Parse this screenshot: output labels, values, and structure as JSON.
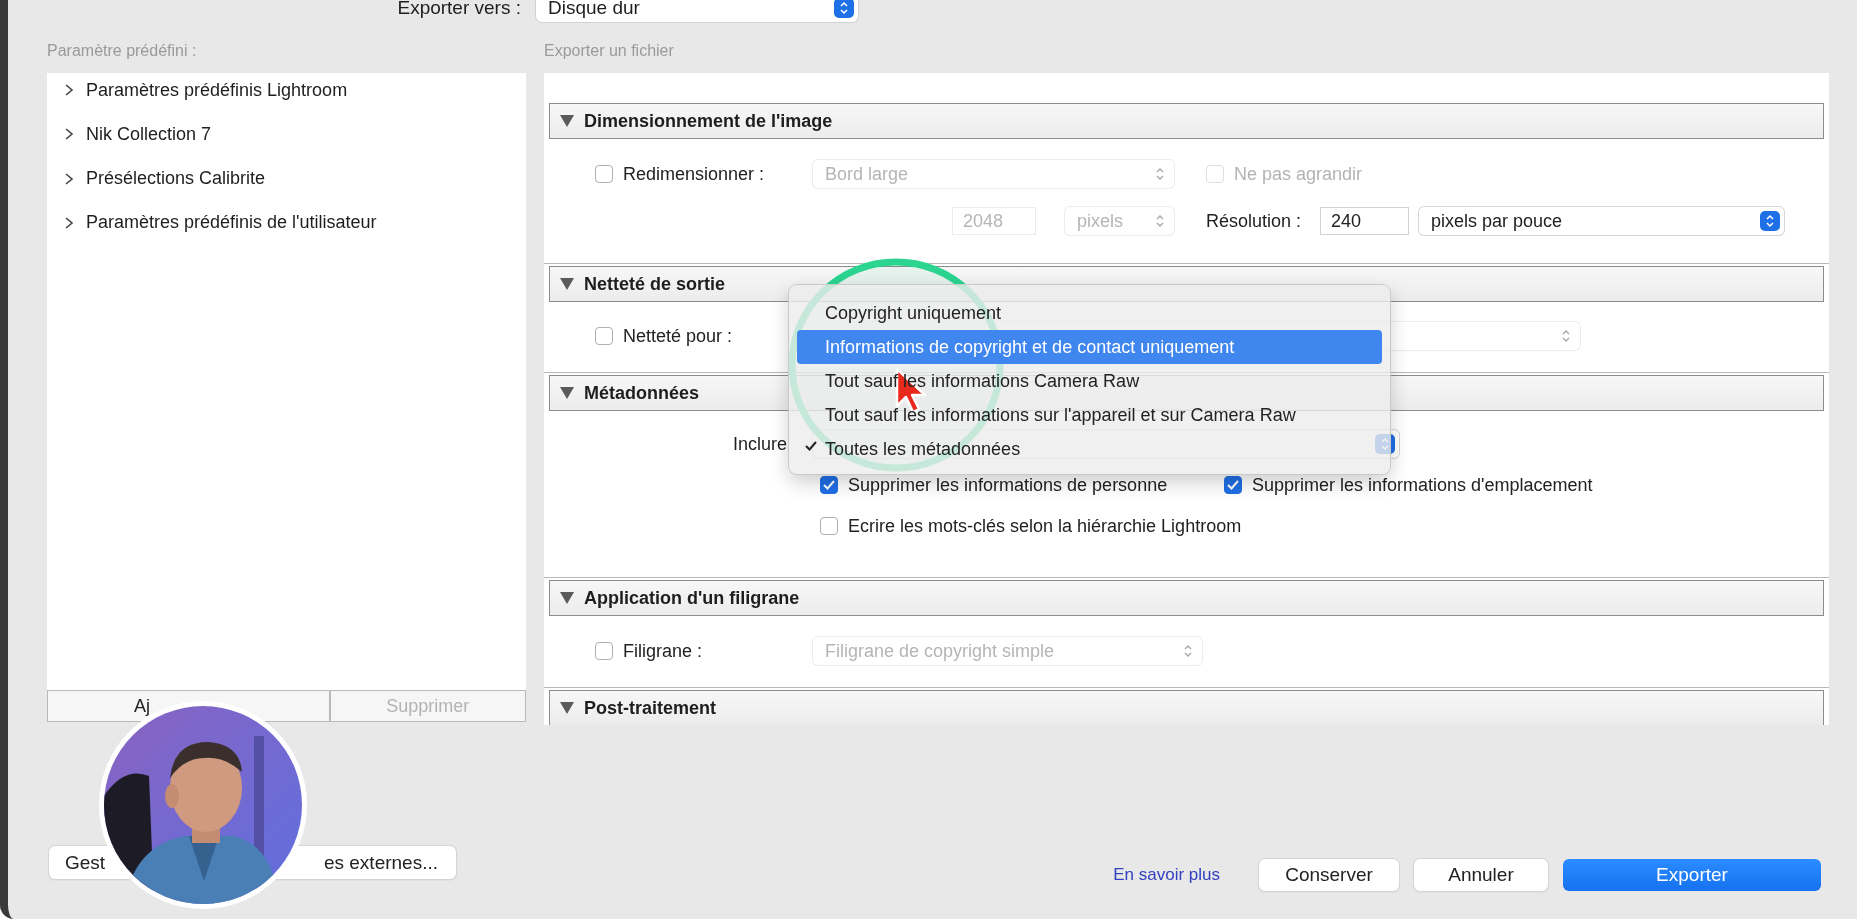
{
  "export_to": {
    "label": "Exporter vers :",
    "value": "Disque dur"
  },
  "presets": {
    "label": "Paramètre prédéfini :",
    "items": [
      {
        "label": "Paramètres prédéfinis Lightroom",
        "expanded": false
      },
      {
        "label": "Nik Collection 7",
        "expanded": false
      },
      {
        "label": "Présélections Calibrite",
        "expanded": false
      },
      {
        "label": "Paramètres prédéfinis de l'utilisateur",
        "expanded": false
      }
    ],
    "buttons": [
      {
        "label": "Aj",
        "disabled": false
      },
      {
        "label": "Supprimer",
        "disabled": true
      }
    ]
  },
  "plugin_manager_button": {
    "label_start": "Gest",
    "label_end": "es externes..."
  },
  "export_panel": {
    "title": "Exporter un fichier",
    "sections": [
      {
        "kind": "sizing",
        "title": "Dimensionnement de l'image",
        "expanded": true,
        "rows": [
          {
            "controls": [
              {
                "kind": "checkbox",
                "label": "Redimensionner :",
                "checked": false,
                "disabled": false
              },
              {
                "kind": "select",
                "value": "Bord large",
                "disabled": true,
                "accent": false
              },
              {
                "kind": "checkbox",
                "label": "Ne pas agrandir",
                "checked": false,
                "disabled": true
              }
            ]
          },
          {
            "controls": [
              {
                "kind": "field",
                "value": "2048",
                "disabled": true
              },
              {
                "kind": "select",
                "value": "pixels",
                "disabled": true,
                "accent": false
              },
              {
                "kind": "label",
                "text": "Résolution :"
              },
              {
                "kind": "field",
                "value": "240",
                "disabled": false
              },
              {
                "kind": "select",
                "value": "pixels par pouce",
                "disabled": false,
                "accent": true
              }
            ]
          }
        ]
      },
      {
        "kind": "sharpening",
        "title": "Netteté de sortie",
        "expanded": true,
        "rows": [
          {
            "controls": [
              {
                "kind": "checkbox",
                "label": "Netteté pour :",
                "checked": false,
                "disabled": false
              },
              {
                "kind": "select",
                "disabled": true,
                "accent": false
              }
            ]
          }
        ]
      },
      {
        "kind": "metadata",
        "title": "Métadonnées",
        "expanded": true,
        "rows": [
          {
            "controls": [
              {
                "kind": "label",
                "text": "Inclure"
              },
              {
                "kind": "select",
                "disabled": false,
                "accent": true
              }
            ]
          },
          {
            "controls": [
              {
                "kind": "checkbox",
                "label": "Supprimer les informations de personne",
                "checked": true,
                "disabled": false
              },
              {
                "kind": "checkbox",
                "label": "Supprimer les informations d'emplacement",
                "checked": true,
                "disabled": false
              }
            ]
          },
          {
            "controls": [
              {
                "kind": "checkbox",
                "label": "Ecrire les mots-clés selon la hiérarchie Lightroom",
                "checked": false,
                "disabled": false
              }
            ]
          }
        ]
      },
      {
        "kind": "watermark",
        "title": "Application d'un filigrane",
        "expanded": true,
        "rows": [
          {
            "controls": [
              {
                "kind": "checkbox",
                "label": "Filigrane :",
                "checked": false,
                "disabled": false
              },
              {
                "kind": "select",
                "value": "Filigrane de copyright simple",
                "disabled": true,
                "accent": false
              }
            ]
          }
        ]
      },
      {
        "kind": "post",
        "title": "Post-traitement",
        "expanded": true
      }
    ]
  },
  "include_menu": {
    "options": [
      {
        "label": "Copyright uniquement",
        "selected": false,
        "checked": false
      },
      {
        "label": "Informations de copyright et de contact uniquement",
        "selected": true,
        "checked": false
      },
      {
        "label": "Tout sauf les informations Camera Raw",
        "selected": false,
        "checked": false
      },
      {
        "label": "Tout sauf les informations sur l'appareil et sur Camera Raw",
        "selected": false,
        "checked": false
      },
      {
        "label": "Toutes les métadonnées",
        "selected": false,
        "checked": true
      }
    ]
  },
  "footer": {
    "link": "En savoir plus",
    "buttons": [
      {
        "label": "Conserver",
        "kind": "secondary"
      },
      {
        "label": "Annuler",
        "kind": "secondary"
      },
      {
        "label": "Exporter",
        "kind": "primary"
      }
    ]
  }
}
